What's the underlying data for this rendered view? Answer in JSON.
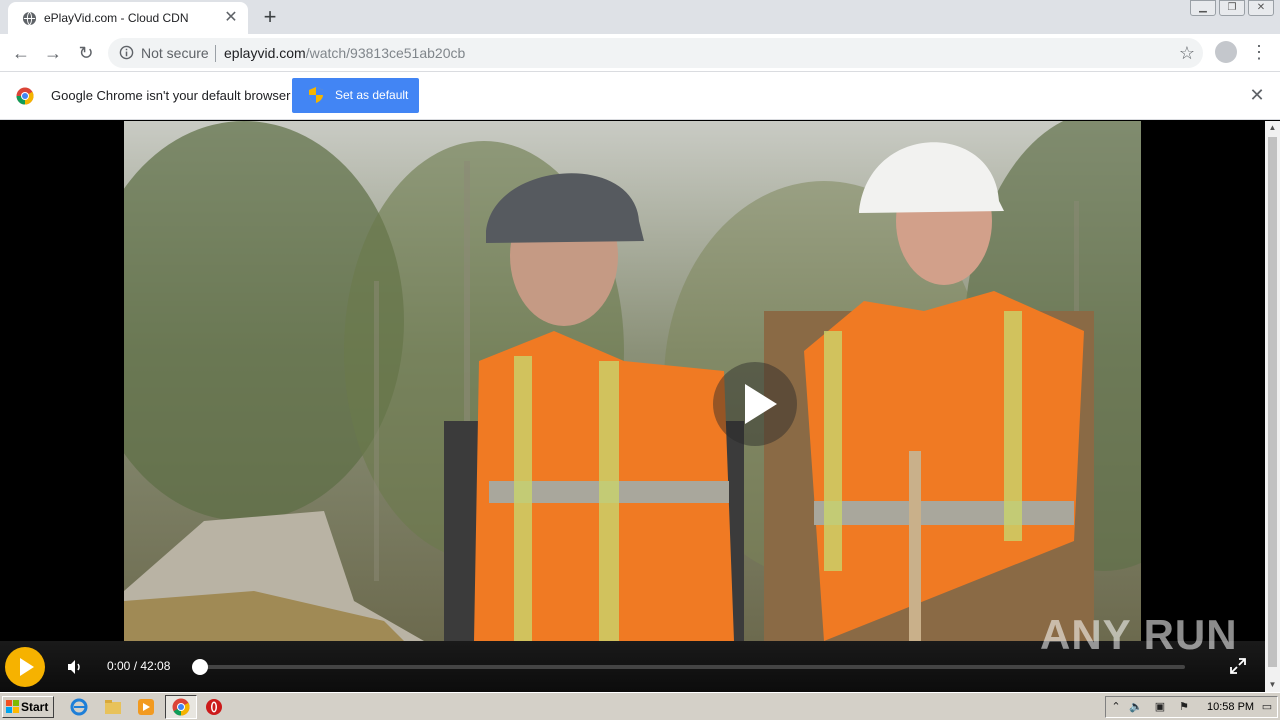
{
  "browser": {
    "tab_title": "ePlayVid.com - Cloud CDN",
    "new_tab_label": "+",
    "security_label": "Not secure",
    "url_host": "eplayvid.com",
    "url_path": "/watch/93813ce51ab20cb"
  },
  "infobar": {
    "message": "Google Chrome isn't your default browser",
    "button_label": "Set as default"
  },
  "player": {
    "time": "0:00 / 42:08",
    "progress": 0.0,
    "watermark": "ANY RUN"
  },
  "taskbar": {
    "start_label": "Start",
    "clock": "10:58 PM"
  },
  "colors": {
    "accent_play": "#f6b200",
    "set_default_button": "#4285f4"
  },
  "icons": [
    "globe-icon",
    "close-icon",
    "back-icon",
    "forward-icon",
    "reload-icon",
    "info-icon",
    "star-icon",
    "profile-icon",
    "menu-icon",
    "chrome-logo-icon",
    "shield-icon",
    "play-icon",
    "volume-icon",
    "fullscreen-icon"
  ]
}
